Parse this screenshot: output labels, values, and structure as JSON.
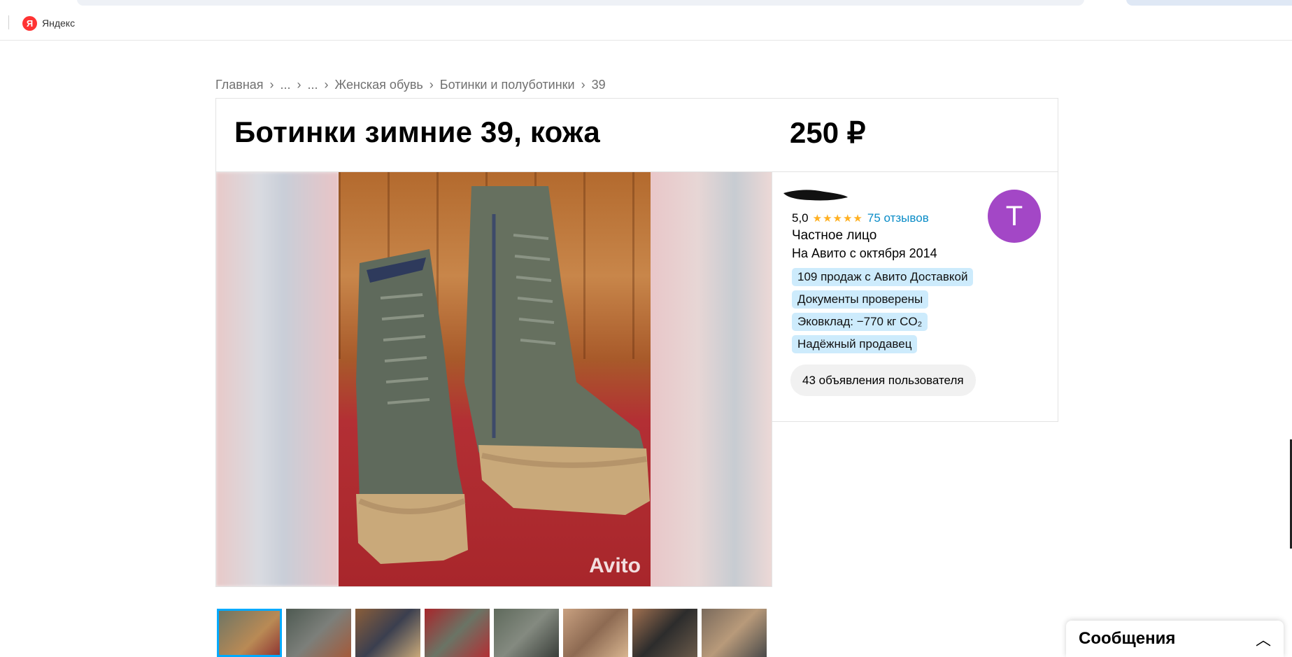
{
  "browser": {
    "bookmark_label": "Яндекс",
    "bookmark_icon": "yandex-logo-icon",
    "bookmark_icon_letter": "Я"
  },
  "breadcrumbs": [
    {
      "label": "Главная"
    },
    {
      "label": "..."
    },
    {
      "label": "..."
    },
    {
      "label": "Женская обувь"
    },
    {
      "label": "Ботинки и полуботинки"
    },
    {
      "label": "39"
    }
  ],
  "breadcrumb_separator": "›",
  "listing": {
    "title": "Ботинки зимние 39, кожа",
    "price": "250 ₽",
    "photo_watermark": "Avito",
    "thumbnails_count": 8,
    "active_thumbnail": 0
  },
  "seller": {
    "rating": "5,0",
    "stars": "★★★★★",
    "reviews": "75 отзывов",
    "type": "Частное лицо",
    "since": "На Авито с октября 2014",
    "avatar_letter": "Т",
    "badges": [
      "109 продаж с Авито Доставкой",
      "Документы проверены",
      "Эковклад: −770 кг CO₂",
      "Надёжный продавец"
    ],
    "ads_button": "43 объявления пользователя"
  },
  "messages": {
    "title": "Сообщения",
    "chevron": "︿"
  },
  "colors": {
    "link": "#0a8cc7",
    "badge_bg": "#cdebfc",
    "avatar_bg": "#a347c6",
    "star": "#ffb021",
    "thumb_active": "#00aaff"
  }
}
